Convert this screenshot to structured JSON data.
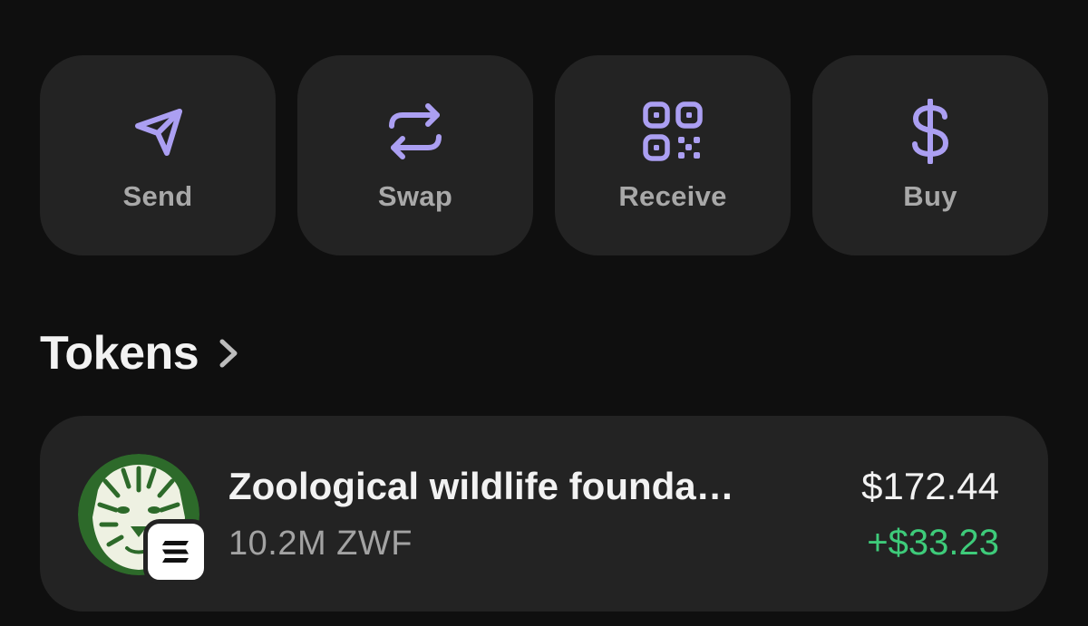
{
  "actions": [
    {
      "label": "Send",
      "icon": "send-icon"
    },
    {
      "label": "Swap",
      "icon": "swap-icon"
    },
    {
      "label": "Receive",
      "icon": "qr-code-icon"
    },
    {
      "label": "Buy",
      "icon": "dollar-icon"
    }
  ],
  "colors": {
    "background": "#0f0f0f",
    "card": "#232323",
    "accent_purple": "#ab9ff2",
    "label_gray": "#a8a8a8",
    "positive_green": "#3ecb7a"
  },
  "tokens_section": {
    "title": "Tokens",
    "chevron_icon": "chevron-right-icon"
  },
  "token_list": [
    {
      "name": "Zoological wildlife founda…",
      "amount": "10.2M ZWF",
      "value": "$172.44",
      "change": "+$33.23",
      "avatar_icon": "tiger-logo-icon",
      "chain_icon": "solana-icon"
    }
  ]
}
